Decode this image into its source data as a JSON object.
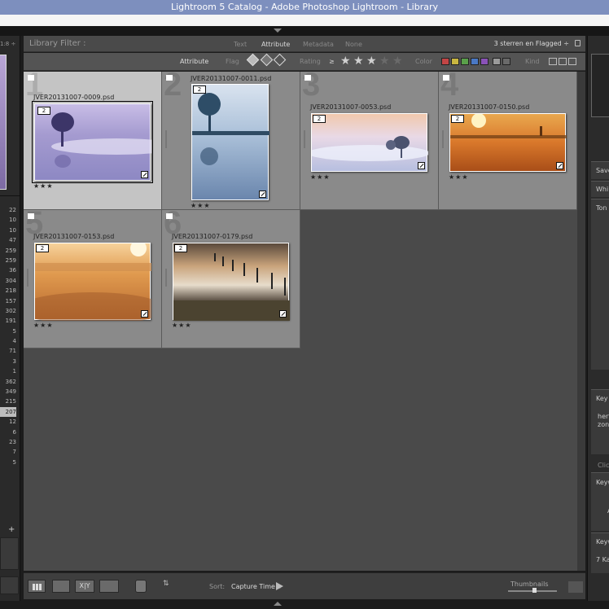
{
  "window": {
    "title": "Lightroom 5 Catalog - Adobe Photoshop Lightroom - Library"
  },
  "left_panel": {
    "top_text": "1:8 ÷",
    "counts": [
      "22",
      "10",
      "10",
      "47",
      "259",
      "259",
      "36",
      "304",
      "218",
      "157",
      "302",
      "191",
      "5",
      "4",
      "71",
      "3",
      "1",
      "362",
      "349",
      "215",
      "207",
      "12",
      "6",
      "23",
      "7",
      "5"
    ],
    "selected_count_index": 20,
    "plus_symbol": "+"
  },
  "filter_bar": {
    "title": "Library Filter :",
    "tabs": [
      "Text",
      "Attribute",
      "Metadata",
      "None"
    ],
    "active_tab": "Attribute",
    "preset": "3 sterren en Flagged ÷"
  },
  "attribute_bar": {
    "label": "Attribute",
    "flag_label": "Flag",
    "rating_label": "Rating",
    "rating_operator": "≥",
    "rating_stars_on": 3,
    "rating_stars_total": 5,
    "color_label": "Color",
    "kind_label": "Kind",
    "color_swatches": [
      "#c24545",
      "#c9b640",
      "#5aa04a",
      "#4a78c4",
      "#8a52b8",
      "#9a9a9a",
      "#6a6a6a"
    ]
  },
  "grid": {
    "cells": [
      {
        "index": "1",
        "filename": "JVER20131007-0009.psd",
        "version": "2",
        "rating": "★★★",
        "selected": true
      },
      {
        "index": "2",
        "filename": "JVER20131007-0011.psd",
        "version": "2",
        "rating": "★★★",
        "selected": false
      },
      {
        "index": "3",
        "filename": "JVER20131007-0053.psd",
        "version": "2",
        "rating": "★★★",
        "selected": false
      },
      {
        "index": "4",
        "filename": "JVER20131007-0150.psd",
        "version": "2",
        "rating": "★★★",
        "selected": false
      },
      {
        "index": "5",
        "filename": "JVER20131007-0153.psd",
        "version": "2",
        "rating": "★★★",
        "selected": false
      },
      {
        "index": "6",
        "filename": "JVER20131007-0179.psd",
        "version": "2",
        "rating": "★★★",
        "selected": false
      }
    ]
  },
  "toolbar": {
    "sort_label": "Sort:",
    "sort_value": "Capture Time ÷",
    "xy_label": "X|Y",
    "thumbnails_label": "Thumbnails"
  },
  "right_panel": {
    "sections": [
      "Save",
      "Whi",
      "Ton",
      "Key",
      "herf",
      "zon",
      "Click",
      "Keyw",
      "A",
      "Keyw",
      "7 Ka"
    ]
  }
}
